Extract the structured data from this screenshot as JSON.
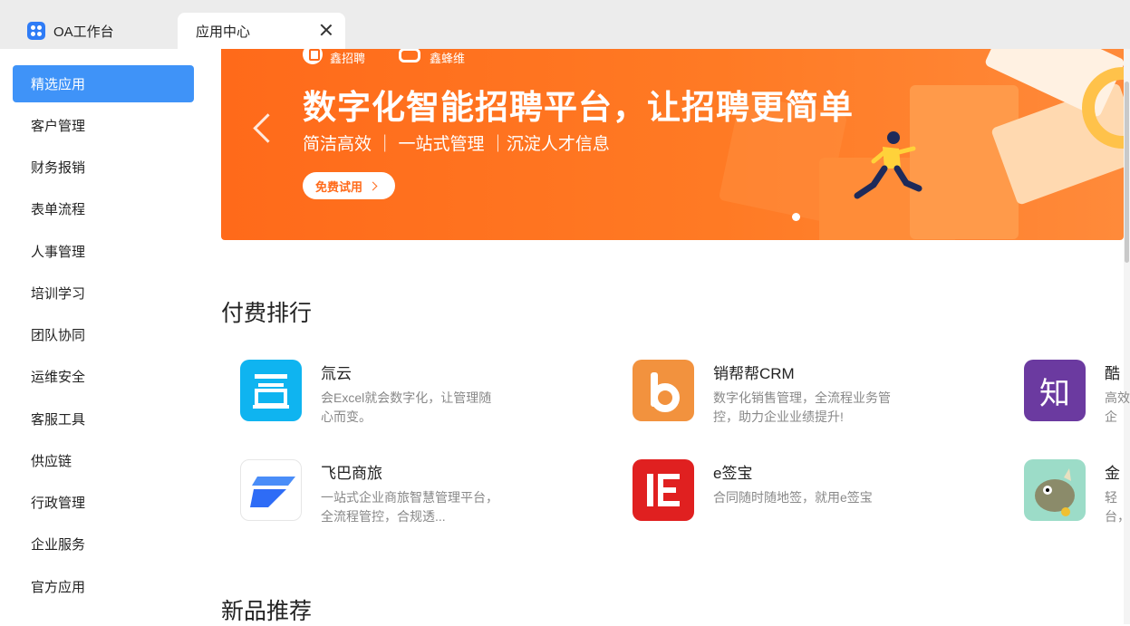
{
  "tabs": [
    {
      "label": "OA工作台",
      "icon": "app-grid-icon",
      "active": false
    },
    {
      "label": "应用中心",
      "active": true
    }
  ],
  "sidebar": {
    "items": [
      {
        "label": "精选应用",
        "active": true
      },
      {
        "label": "客户管理"
      },
      {
        "label": "财务报销"
      },
      {
        "label": "表单流程"
      },
      {
        "label": "人事管理"
      },
      {
        "label": "培训学习"
      },
      {
        "label": "团队协同"
      },
      {
        "label": "运维安全"
      },
      {
        "label": "客服工具"
      },
      {
        "label": "供应链"
      },
      {
        "label": "行政管理"
      },
      {
        "label": "企业服务"
      },
      {
        "label": "官方应用"
      }
    ]
  },
  "banner": {
    "brands": [
      "鑫招聘",
      "鑫蜂维"
    ],
    "title": "数字化智能招聘平台，让招聘更简单",
    "subtitle": "简洁高效 ｜ 一站式管理 ｜沉淀人才信息",
    "button": "免费试用",
    "color": "#ff6a1a"
  },
  "sections": {
    "paid_ranking": {
      "title": "付费排行",
      "apps": [
        {
          "name": "氚云",
          "desc": "会Excel就会数字化，让管理随心而变。",
          "icon": "chuanyun-icon",
          "color": "#0fb4f0"
        },
        {
          "name": "销帮帮CRM",
          "desc": "数字化销售管理，全流程业务管控，助力企业业绩提升!",
          "icon": "xiaobangbang-icon",
          "color": "#f2923e"
        },
        {
          "name": "酷",
          "desc": "高效企",
          "icon": "zhi-icon",
          "glyph": "知",
          "color": "#6b3aa0"
        },
        {
          "name": "飞巴商旅",
          "desc": "一站式企业商旅智慧管理平台， 全流程管控，合规透...",
          "icon": "feiba-icon",
          "color": "#2e6cf6"
        },
        {
          "name": "e签宝",
          "desc": "合同随时随地签，就用e签宝",
          "icon": "esign-icon",
          "color": "#e02020"
        },
        {
          "name": "金",
          "desc": "轻台，",
          "icon": "rhino-icon",
          "color": "#9cdcc8"
        }
      ]
    },
    "new_products": {
      "title": "新品推荐"
    }
  }
}
